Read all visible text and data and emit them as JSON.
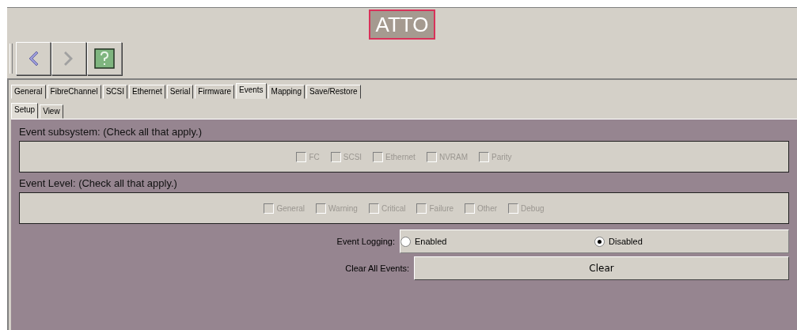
{
  "logo": {
    "text": "ATTO"
  },
  "toolbar": [
    {
      "kind": "back",
      "disabled": false
    },
    {
      "kind": "forward",
      "disabled": true
    },
    {
      "kind": "help",
      "disabled": false
    }
  ],
  "tabs": [
    {
      "label": "General",
      "selected": false
    },
    {
      "label": "FibreChannel",
      "selected": false
    },
    {
      "label": "SCSI",
      "selected": false
    },
    {
      "label": "Ethernet",
      "selected": false
    },
    {
      "label": "Serial",
      "selected": false
    },
    {
      "label": "Firmware",
      "selected": false
    },
    {
      "label": "Events",
      "selected": true
    },
    {
      "label": "Mapping",
      "selected": false
    },
    {
      "label": "Save/Restore",
      "selected": false
    }
  ],
  "subtabs": [
    {
      "label": "Setup",
      "selected": true
    },
    {
      "label": "View",
      "selected": false
    }
  ],
  "groups": [
    {
      "heading": "Event subsystem: (Check all that apply.)",
      "options": [
        {
          "label": "FC",
          "checked": false,
          "disabled": true
        },
        {
          "label": "SCSI",
          "checked": false,
          "disabled": true
        },
        {
          "label": "Ethernet",
          "checked": false,
          "disabled": true
        },
        {
          "label": "NVRAM",
          "checked": false,
          "disabled": true
        },
        {
          "label": "Parity",
          "checked": false,
          "disabled": true
        }
      ]
    },
    {
      "heading": "Event Level: (Check all that apply.)",
      "options": [
        {
          "label": "General",
          "checked": false,
          "disabled": true
        },
        {
          "label": "Warning",
          "checked": false,
          "disabled": true
        },
        {
          "label": "Critical",
          "checked": false,
          "disabled": true
        },
        {
          "label": "Failure",
          "checked": false,
          "disabled": true
        },
        {
          "label": "Other",
          "checked": false,
          "disabled": true
        },
        {
          "label": "Debug",
          "checked": false,
          "disabled": true
        }
      ]
    }
  ],
  "event_logging": {
    "label": "Event Logging:",
    "options": [
      {
        "label": "Enabled",
        "selected": false
      },
      {
        "label": "Disabled",
        "selected": true
      }
    ]
  },
  "clear_events": {
    "label": "Clear All Events:",
    "button": "Clear"
  }
}
